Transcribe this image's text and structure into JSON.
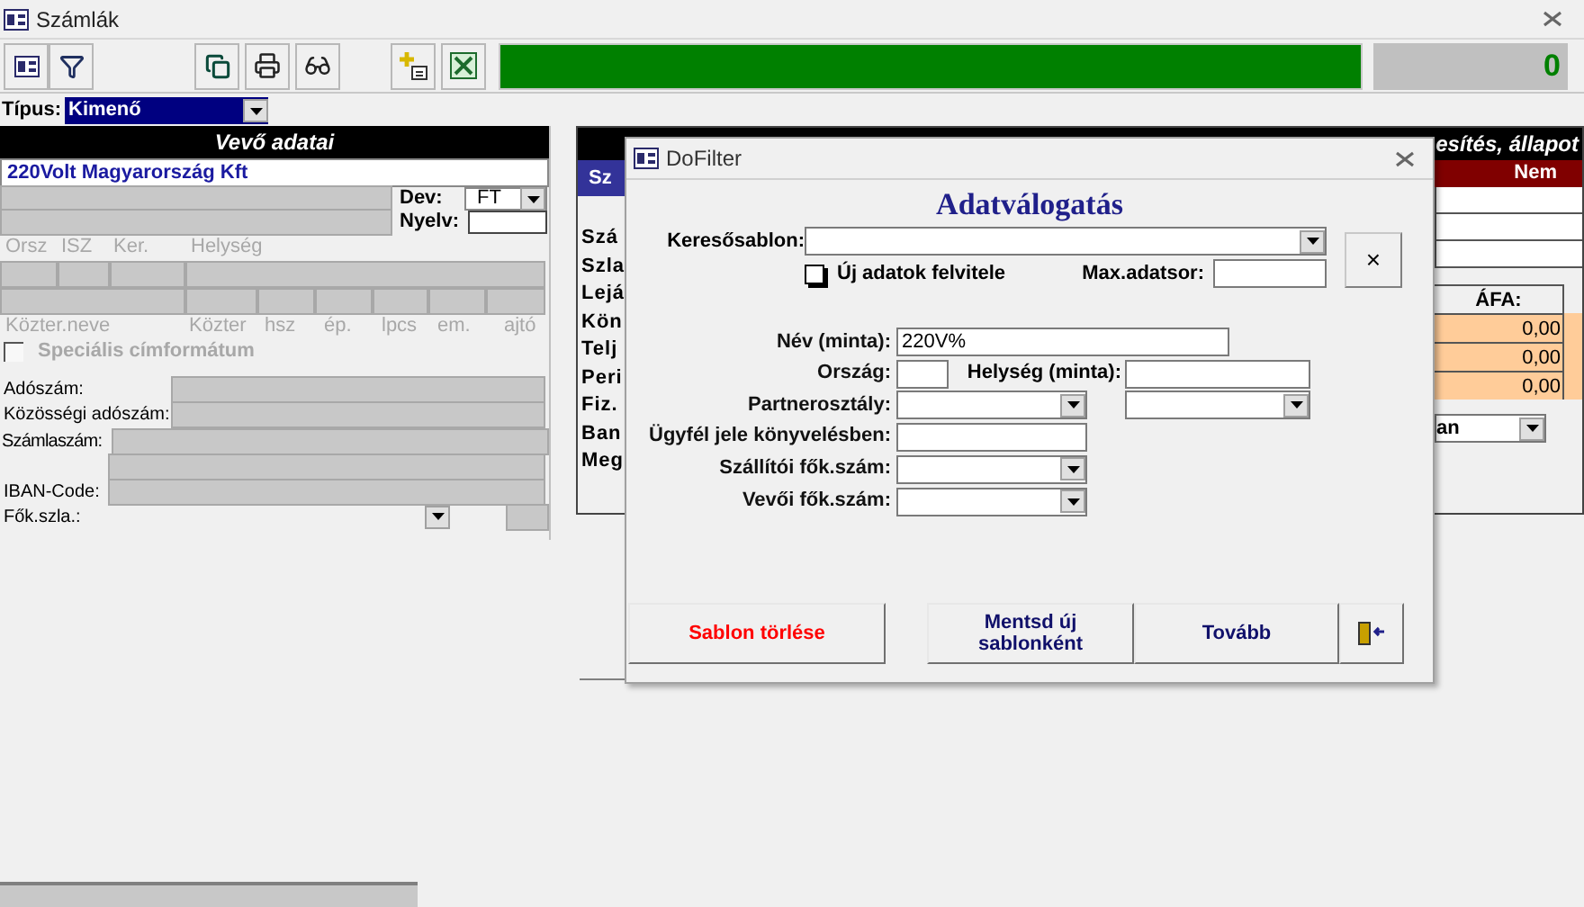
{
  "window": {
    "title": "Számlák"
  },
  "toolbar": {
    "progress": {
      "level": 1
    },
    "counter": "0"
  },
  "type_field": {
    "label": "Típus:",
    "value": "Kimenő"
  },
  "customer": {
    "header": "Vevő adatai",
    "name": "220Volt Magyarország Kft",
    "currency_label": "Dev:",
    "currency": "FT",
    "language_label": "Nyelv:",
    "address_labels_top": [
      "Orsz",
      "ISZ",
      "Ker.",
      "Helység"
    ],
    "address_labels_bottom": [
      "Közter.neve",
      "Közter",
      "hsz",
      "ép.",
      "lpcs",
      "em.",
      "ajtó"
    ],
    "special_format": {
      "label": "Speciális címformátum",
      "checked": false,
      "disabled": true
    },
    "tax_number_label": "Adószám:",
    "community_tax_label": "Közösségi adószám:",
    "account_number_label": "Számlaszám:",
    "iban_label": "IBAN-Code:",
    "main_account_label": "Fők.szla.:"
  },
  "invoice": {
    "header_left": "Sz",
    "labels": [
      "Szá",
      "Szla",
      "Lejá",
      "Kön",
      "Telj",
      "Peri",
      "Fiz.",
      "Ban",
      "Meg"
    ],
    "status_header": "esítés, állapot",
    "status_value": "Nem",
    "vat_header": "ÁFA:",
    "vat_values": [
      "0,00",
      "0,00",
      "0,00"
    ],
    "dropdown_value": "an"
  },
  "dialog": {
    "title": "DoFilter",
    "heading": "Adatválogatás",
    "template_label": "Keresősablon:",
    "new_data": {
      "label": "Új adatok felvitele",
      "checked": false
    },
    "max_rows_label": "Max.adatsor:",
    "close_label": "×",
    "name_label": "Név (minta):",
    "name_value": "220V%",
    "country_label": "Ország:",
    "city_label": "Helység (minta):",
    "partner_class_label": "Partnerosztály:",
    "client_mark_label": "Ügyfél jele könyvelésben:",
    "supplier_account_label": "Szállítói fők.szám:",
    "customer_account_label": "Vevői fők.szám:",
    "buttons": [
      {
        "label": "Sablon törlése",
        "kind": "danger"
      },
      {
        "label": "Mentsd új sablonként",
        "kind": "normal"
      },
      {
        "label": "Tovább",
        "kind": "normal"
      },
      {
        "kind": "exit"
      }
    ]
  }
}
